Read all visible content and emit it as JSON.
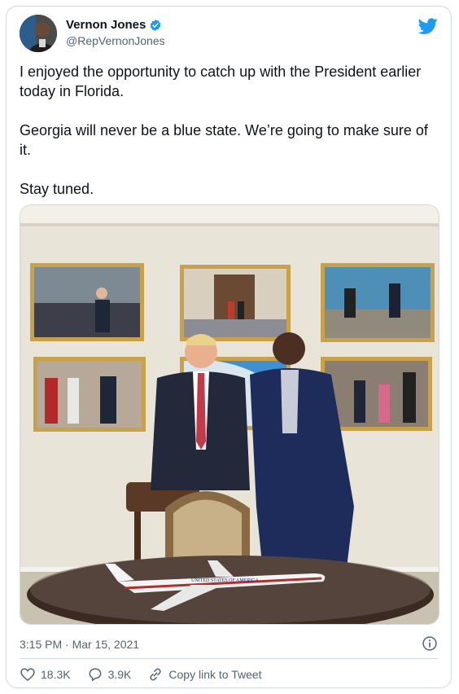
{
  "author": {
    "display_name": "Vernon Jones",
    "handle": "@RepVernonJones",
    "verified": true
  },
  "tweet": {
    "paragraphs": [
      "I enjoyed the opportunity to catch up with the President earlier today in Florida.",
      "Georgia will never be a blue state. We’re going to make sure of it.",
      "Stay tuned."
    ],
    "timestamp": "3:15 PM · Mar 15, 2021"
  },
  "photo": {
    "plane_livery_text": "UNITED STATES OF AMERICA"
  },
  "actions": {
    "likes": "18.3K",
    "replies": "3.9K",
    "copy_link_label": "Copy link to Tweet"
  },
  "icons": {
    "brand": "twitter-bird-icon",
    "verified": "verified-badge-icon",
    "info": "info-icon",
    "like": "heart-icon",
    "reply": "reply-icon",
    "link": "link-icon"
  },
  "colors": {
    "accent": "#1d9bf0",
    "text": "#0f1419",
    "muted": "#536471",
    "border": "#cfd9de"
  }
}
